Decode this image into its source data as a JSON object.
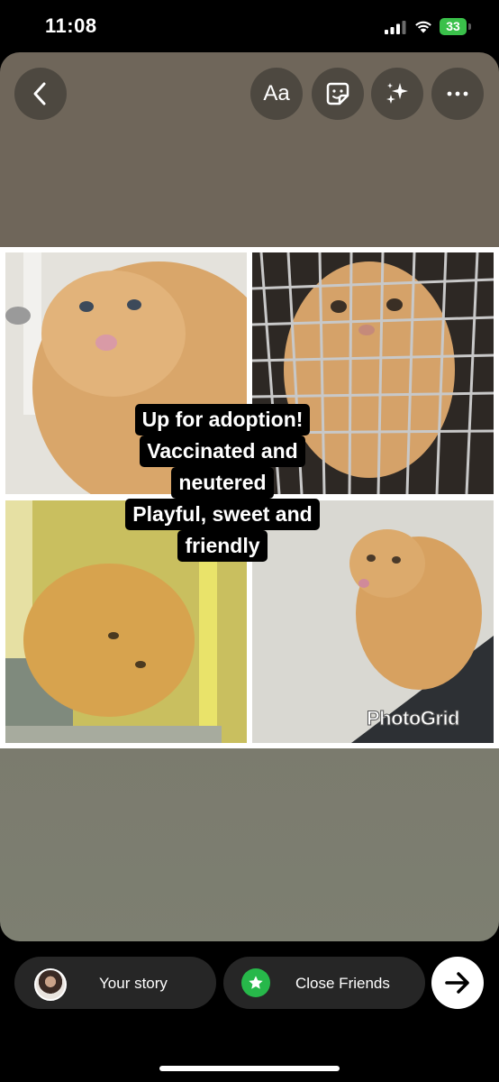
{
  "status_bar": {
    "time": "11:08",
    "battery": "33"
  },
  "toolbar": {
    "text_label": "Aa"
  },
  "caption": {
    "lines": [
      "Up for adoption!",
      "Vaccinated and",
      "neutered",
      "Playful, sweet and",
      "friendly"
    ]
  },
  "watermark": "PhotoGrid",
  "share": {
    "your_story": "Your story",
    "close_friends": "Close Friends"
  },
  "icons": {
    "back": "chevron-left-icon",
    "sticker": "sticker-icon",
    "effects": "sparkles-icon",
    "more": "more-horizontal-icon",
    "star": "star-icon",
    "next": "arrow-right-icon"
  },
  "colors": {
    "close_friends_green": "#27b84a",
    "battery_green": "#3ac04a"
  }
}
